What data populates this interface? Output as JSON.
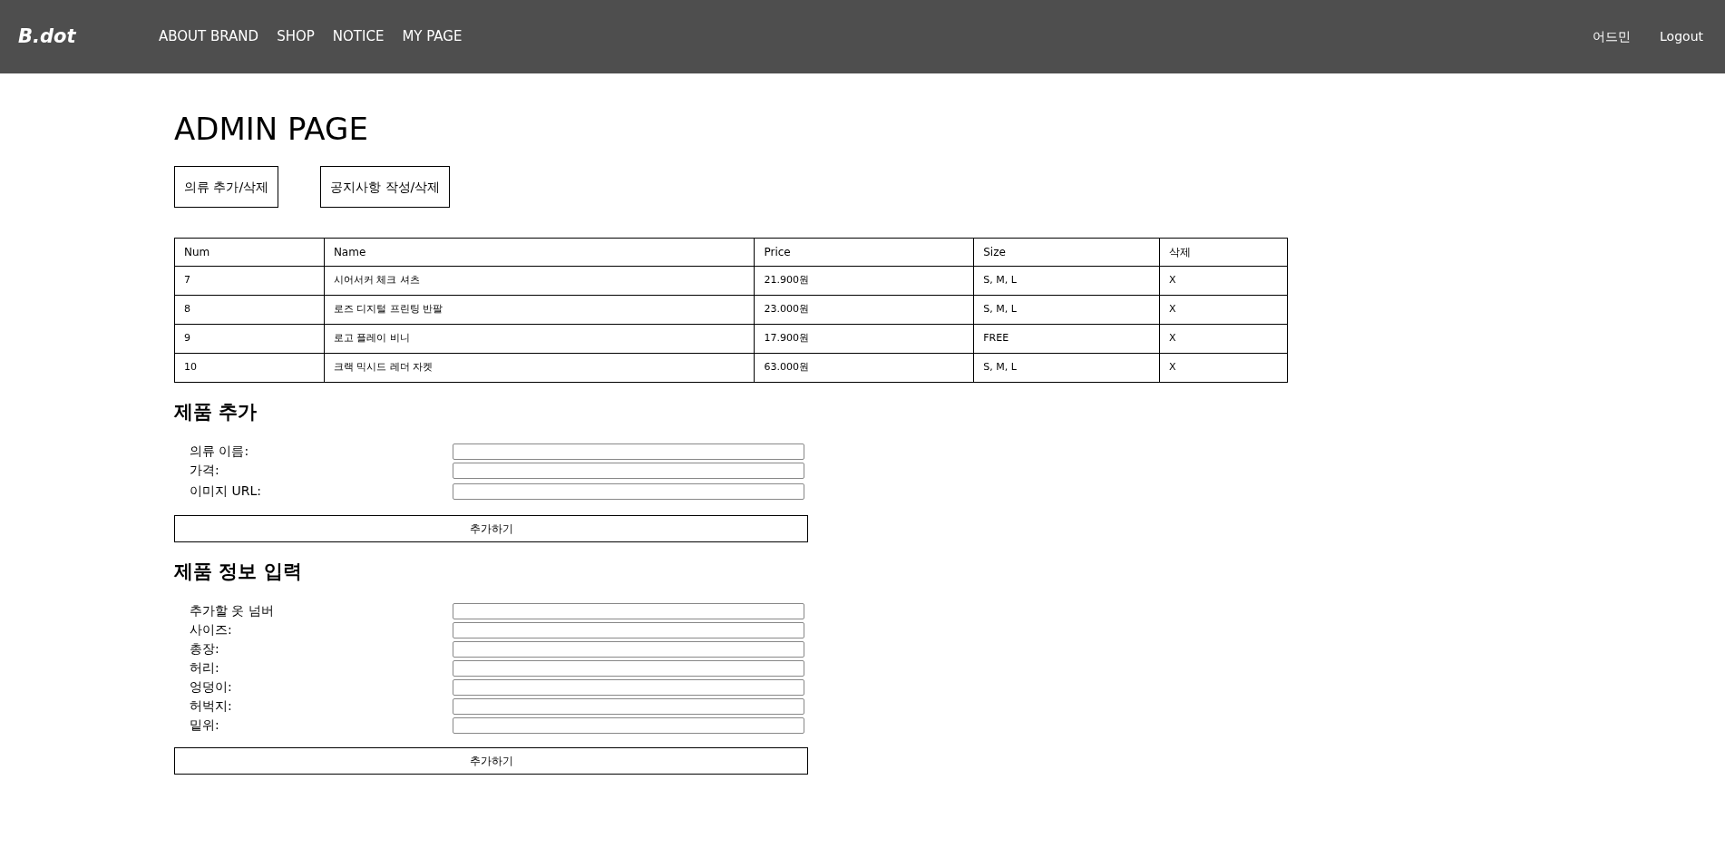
{
  "header": {
    "logo": "B.dot",
    "nav": [
      "ABOUT BRAND",
      "SHOP",
      "NOTICE",
      "MY PAGE"
    ],
    "user": "어드민",
    "logout": "Logout"
  },
  "title": "ADMIN PAGE",
  "tabs": [
    "의류 추가/삭제",
    "공지사항 작성/삭제"
  ],
  "table": {
    "columns": [
      "Num",
      "Name",
      "Price",
      "Size",
      "삭제"
    ],
    "rows": [
      [
        "7",
        "시어서커 체크 셔츠",
        "21.900원",
        "S, M, L",
        "X"
      ],
      [
        "8",
        "로즈 디지털 프린팅 반팔",
        "23.000원",
        "S, M, L",
        "X"
      ],
      [
        "9",
        "로고 플레이 비니",
        "17.900원",
        "FREE",
        "X"
      ],
      [
        "10",
        "크랙 믹시드 레더 자켓",
        "63.000원",
        "S, M, L",
        "X"
      ]
    ]
  },
  "forms": [
    {
      "heading": "제품 추가",
      "fields": [
        "의류 이름:",
        "가격:",
        "이미지 URL:"
      ],
      "button": "추가하기"
    },
    {
      "heading": "제품 정보 입력",
      "fields": [
        "추가할 옷 넘버",
        "사이즈:",
        "총장:",
        "허리:",
        "엉덩이:",
        "허벅지:",
        "밑위:"
      ],
      "button": "추가하기"
    }
  ]
}
